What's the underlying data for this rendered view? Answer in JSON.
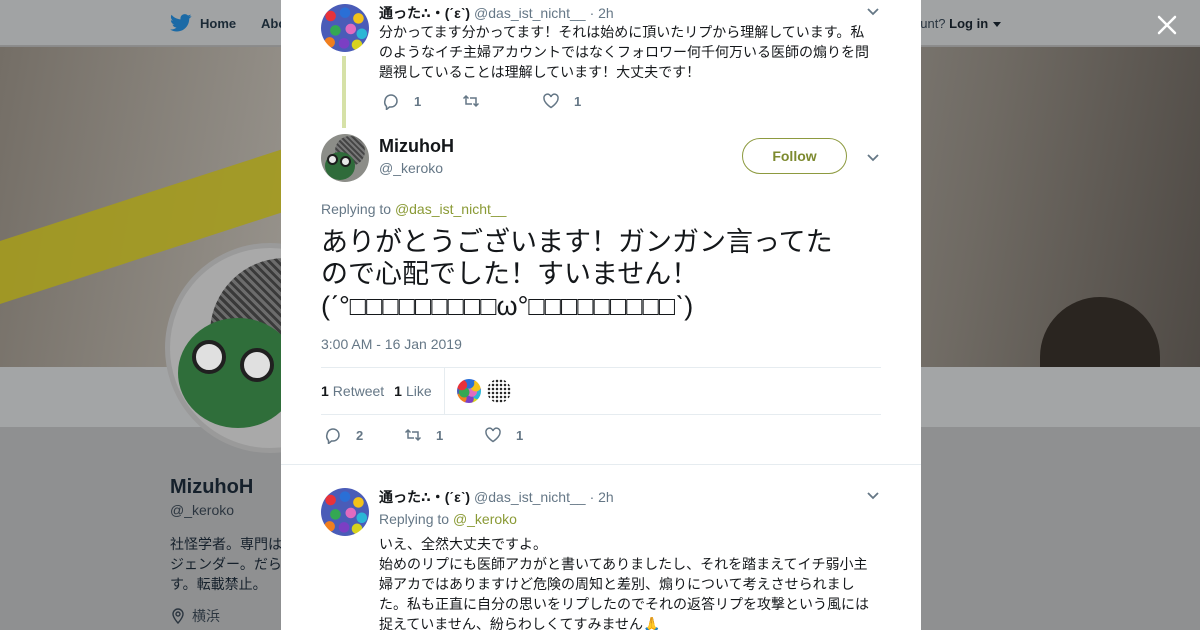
{
  "background": {
    "nav_home": "Home",
    "nav_about": "Abo",
    "login_prompt": "ccount?",
    "login_link": "Log in",
    "profile_name": "MizuhoH",
    "profile_handle": "@_keroko",
    "bio_lines": [
      "社怪学者。専門は",
      "ジェンダー。だら",
      "す。転載禁止。"
    ],
    "location": "横浜"
  },
  "modal": {
    "parent_tweet": {
      "name": "通った∴・(ˊεˋ)",
      "handle": "@das_ist_nicht__",
      "time": "· 2h",
      "text": "分かってます分かってます！それは始めに頂いたリプから理解しています。私のようなイチ主婦アカウントではなくフォロワー何千何万いる医師の煽りを問題視していることは理解しています！大丈夫です！",
      "reply_count": "1",
      "retweet_count": "",
      "like_count": "1"
    },
    "main_tweet": {
      "name": "MizuhoH",
      "handle": "@_keroko",
      "follow_label": "Follow",
      "replying_to_label": "Replying to",
      "replying_to_mention": "@das_ist_nicht__",
      "text_line1": "ありがとうございます！ガンガン言ってた",
      "text_line2": "ので心配でした！すいません！",
      "text_line3": "(ˊ°□□□□□□□□□ω°□□□□□□□□□ˋ)",
      "timestamp": "3:00 AM - 16 Jan 2019",
      "retweets_num": "1",
      "retweets_label": "Retweet",
      "likes_num": "1",
      "likes_label": "Like",
      "reply_count": "2",
      "retweet_count": "1",
      "like_count": "1"
    },
    "reply_tweet": {
      "name": "通った∴・(ˊεˋ)",
      "handle": "@das_ist_nicht__",
      "time": "· 2h",
      "replying_to_label": "Replying to",
      "replying_to_mention": "@_keroko",
      "line1": "いえ、全然大丈夫ですよ。",
      "line2": "始めのリプにも医師アカがと書いてありましたし、それを踏まえてイチ弱小主婦アカではありますけど危険の周知と差別、煽りについて考えさせられました。私も正直に自分の思いをリプしたのでそれの返答リプを攻撃という風には捉えていません、紛らわしくてすみません🙏"
    }
  },
  "colors": {
    "accent": "#8a9a35",
    "follow_border": "#8d9a3f",
    "muted_text": "#657786",
    "thread_line": "#d6e1a7"
  },
  "icons": [
    "twitter-bird-icon",
    "caret-down-icon",
    "close-icon",
    "reply-icon",
    "retweet-icon",
    "heart-icon",
    "chevron-down-icon",
    "location-pin-icon"
  ]
}
